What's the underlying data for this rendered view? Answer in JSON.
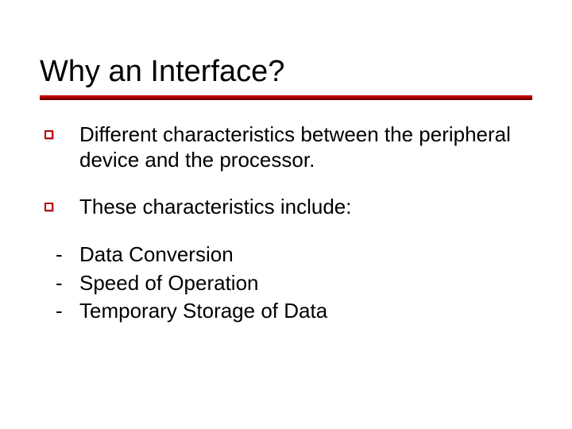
{
  "slide": {
    "title": "Why an Interface?",
    "bullets": {
      "b1": "Different characteristics between the peripheral device and the processor.",
      "b2": " These characteristics include:"
    },
    "dashes": {
      "d1": "Data Conversion",
      "d2": "Speed of Operation",
      "d3": "Temporary Storage of Data"
    }
  }
}
